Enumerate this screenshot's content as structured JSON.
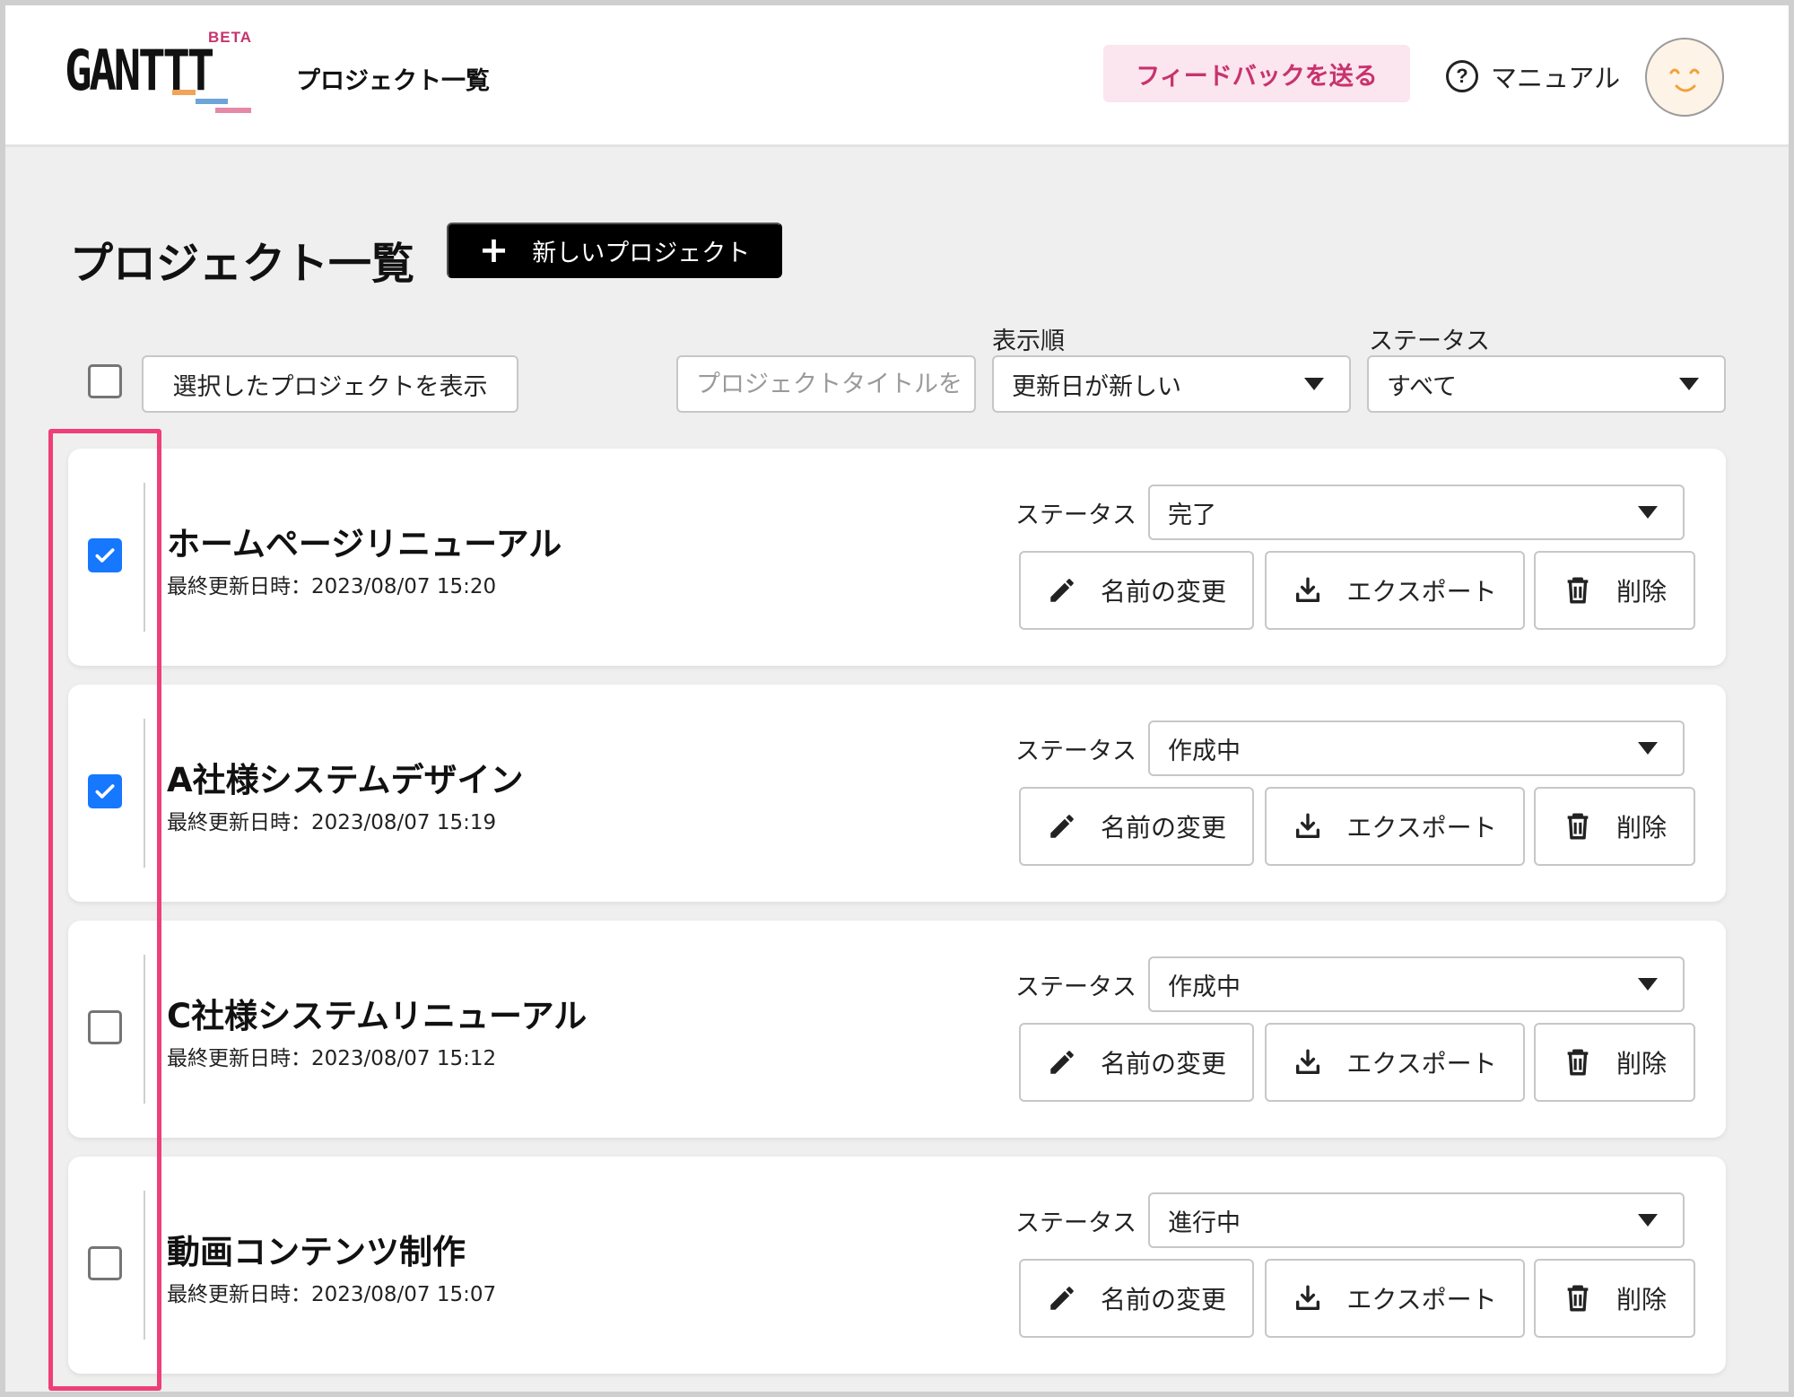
{
  "header": {
    "logo_text": "GANTTT",
    "logo_badge": "BETA",
    "title": "プロジェクト一覧",
    "feedback_label": "フィードバックを送る",
    "manual_label": "マニュアル",
    "help_icon_glyph": "?"
  },
  "page": {
    "title": "プロジェクト一覧",
    "new_project_label": "新しいプロジェクト",
    "new_project_icon": "+"
  },
  "filters": {
    "select_all_checked": false,
    "show_selected_label": "選択したプロジェクトを表示",
    "search_placeholder": "プロジェクトタイトルを",
    "sort_label": "表示順",
    "sort_value": "更新日が新しい",
    "status_label": "ステータス",
    "status_value": "すべて"
  },
  "projects": [
    {
      "name": "ホームページリニューアル",
      "updated": "最終更新日時：2023/08/07 15:20",
      "checked": true,
      "status_label": "ステータス",
      "status": "完了",
      "rename_label": "名前の変更",
      "export_label": "エクスポート",
      "delete_label": "削除"
    },
    {
      "name": "A社様システムデザイン",
      "updated": "最終更新日時：2023/08/07 15:19",
      "checked": true,
      "status_label": "ステータス",
      "status": "作成中",
      "rename_label": "名前の変更",
      "export_label": "エクスポート",
      "delete_label": "削除"
    },
    {
      "name": "C社様システムリニューアル",
      "updated": "最終更新日時：2023/08/07 15:12",
      "checked": false,
      "status_label": "ステータス",
      "status": "作成中",
      "rename_label": "名前の変更",
      "export_label": "エクスポート",
      "delete_label": "削除"
    },
    {
      "name": "動画コンテンツ制作",
      "updated": "最終更新日時：2023/08/07 15:07",
      "checked": false,
      "status_label": "ステータス",
      "status": "進行中",
      "rename_label": "名前の変更",
      "export_label": "エクスポート",
      "delete_label": "削除"
    }
  ],
  "colors": {
    "accent_pink": "#c7336e",
    "feedback_bg": "#fbe5ee",
    "checkbox_checked": "#1677ff",
    "highlight_border": "#ee3f78"
  },
  "icons": {
    "rename": "pencil-icon",
    "export": "download-icon",
    "delete": "trash-icon",
    "help": "question-circle-icon",
    "avatar": "smiley-face-icon"
  }
}
